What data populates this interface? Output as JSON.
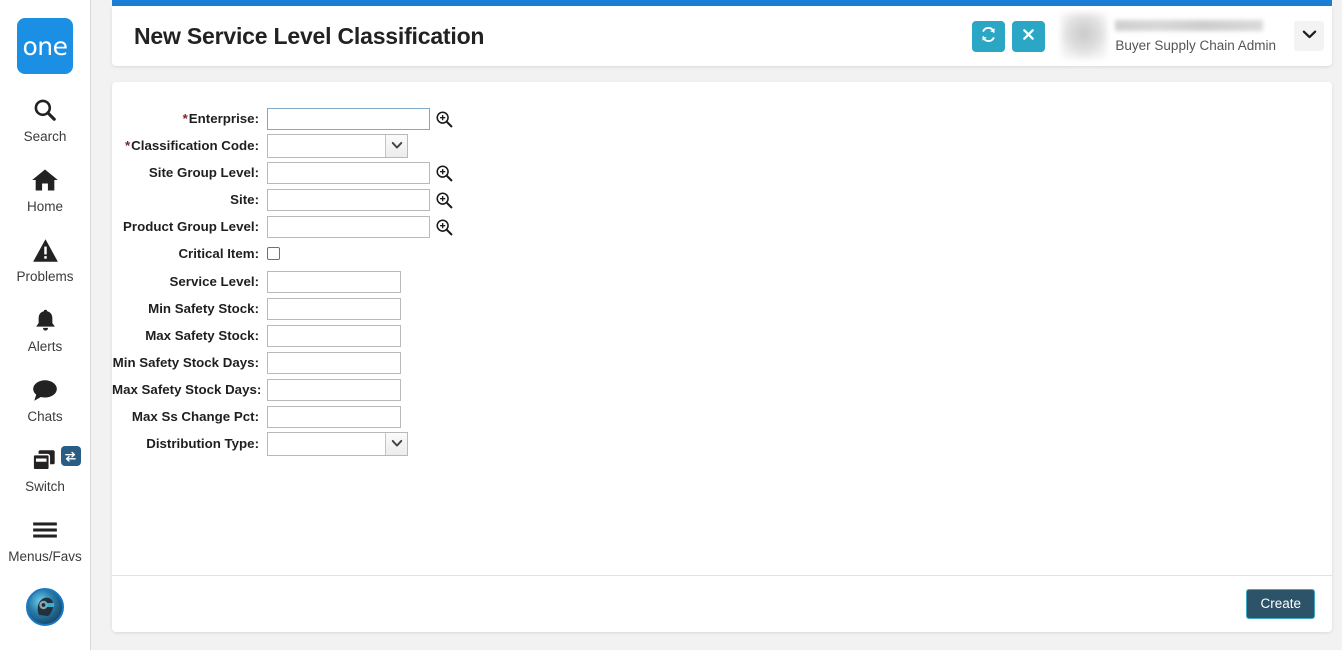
{
  "app": {
    "logo_text": "one",
    "accent_blue": "#1a8fe3",
    "strip_blue": "#1a7fd4",
    "teal": "#2ba6c4",
    "create_navy": "#2d5369",
    "required_red": "#8a1f1f"
  },
  "sidebar": {
    "items": [
      {
        "label": "Search",
        "icon": "search-icon"
      },
      {
        "label": "Home",
        "icon": "home-icon"
      },
      {
        "label": "Problems",
        "icon": "warning-triangle-icon"
      },
      {
        "label": "Alerts",
        "icon": "bell-icon"
      },
      {
        "label": "Chats",
        "icon": "chat-bubble-icon"
      },
      {
        "label": "Switch",
        "icon": "windows-stack-icon",
        "badge_icon": "swap-arrows-icon"
      },
      {
        "label": "Menus/Favs",
        "icon": "hamburger-menu-icon"
      }
    ],
    "avatar_icon": "user-avatar"
  },
  "header": {
    "title": "New Service Level Classification",
    "refresh_icon": "refresh-icon",
    "close_icon": "close-icon",
    "user_role": "Buyer Supply Chain Admin",
    "user_name": "",
    "dropdown_icon": "chevron-down-icon"
  },
  "form": {
    "fields": [
      {
        "label": "Enterprise",
        "required": true,
        "type": "text-lookup",
        "value": "",
        "focused": true,
        "width": "wide"
      },
      {
        "label": "Classification Code",
        "required": true,
        "type": "select",
        "value": "",
        "focused": false
      },
      {
        "label": "Site Group Level",
        "required": false,
        "type": "text-lookup",
        "value": "",
        "focused": false,
        "width": "wide"
      },
      {
        "label": "Site",
        "required": false,
        "type": "text-lookup",
        "value": "",
        "focused": false,
        "width": "wide"
      },
      {
        "label": "Product Group Level",
        "required": false,
        "type": "text-lookup",
        "value": "",
        "focused": false,
        "width": "wide"
      },
      {
        "label": "Critical Item",
        "required": false,
        "type": "checkbox",
        "checked": false
      },
      {
        "label": "Service Level",
        "required": false,
        "type": "text",
        "value": "",
        "focused": false,
        "width": "short"
      },
      {
        "label": "Min Safety Stock",
        "required": false,
        "type": "text",
        "value": "",
        "focused": false,
        "width": "short"
      },
      {
        "label": "Max Safety Stock",
        "required": false,
        "type": "text",
        "value": "",
        "focused": false,
        "width": "short"
      },
      {
        "label": "Min Safety Stock Days",
        "required": false,
        "type": "text",
        "value": "",
        "focused": false,
        "width": "short"
      },
      {
        "label": "Max Safety Stock Days",
        "required": false,
        "type": "text",
        "value": "",
        "focused": false,
        "width": "short"
      },
      {
        "label": "Max Ss Change Pct",
        "required": false,
        "type": "text",
        "value": "",
        "focused": false,
        "width": "short"
      },
      {
        "label": "Distribution Type",
        "required": false,
        "type": "select",
        "value": "",
        "focused": false
      }
    ]
  },
  "footer": {
    "create_label": "Create"
  }
}
